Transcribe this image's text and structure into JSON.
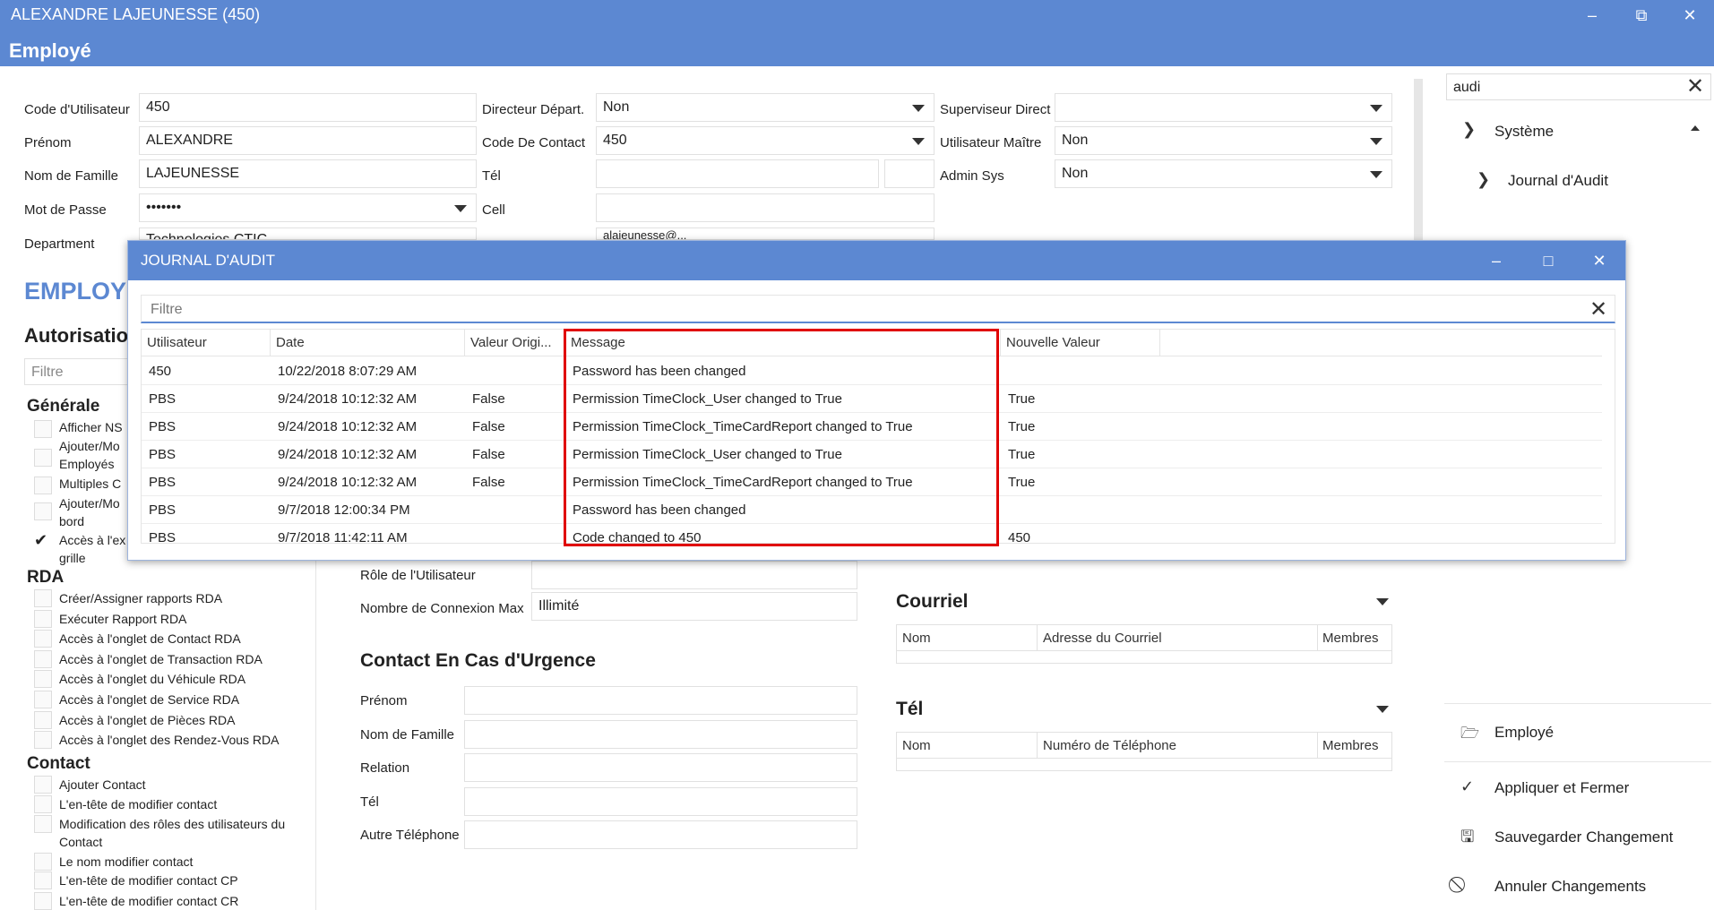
{
  "window": {
    "title": "ALEXANDRE LAJEUNESSE (450)",
    "subtitle": "Employé",
    "minimize_icon": "minimize-icon",
    "restore_icon": "restore-icon",
    "close_icon": "close-icon"
  },
  "form": {
    "col1": [
      {
        "label": "Code d'Utilisateur",
        "value": "450"
      },
      {
        "label": "Prénom",
        "value": "ALEXANDRE"
      },
      {
        "label": "Nom de Famille",
        "value": "LAJEUNESSE"
      },
      {
        "label": "Mot de Passe",
        "value": "•••••••"
      },
      {
        "label": "Department",
        "value": "Technologies CTIC"
      }
    ],
    "col2": [
      {
        "label": "Directeur Départ.",
        "value": "Non"
      },
      {
        "label": "Code De Contact",
        "value": "450"
      },
      {
        "label": "Tél",
        "value": ""
      },
      {
        "label": "Cell",
        "value": ""
      },
      {
        "label": "",
        "value": "alajeunesse@..."
      }
    ],
    "col3": [
      {
        "label": "Superviseur Direct",
        "value": ""
      },
      {
        "label": "Utilisateur Maître",
        "value": "Non"
      },
      {
        "label": "Admin Sys",
        "value": "Non"
      }
    ]
  },
  "left": {
    "heading": "EMPLOYÉ",
    "autorisation": "Autorisation",
    "filter_placeholder": "Filtre",
    "groups": {
      "generale": "Générale",
      "rda": "RDA",
      "contact": "Contact"
    },
    "generale_items": [
      "Afficher NS",
      "Ajouter/Mo",
      "Employés",
      "Multiples C",
      "Ajouter/Mo",
      "bord",
      "Accès à l'ex",
      "grille"
    ],
    "rda_items": [
      "Créer/Assigner rapports RDA",
      "Exécuter Rapport RDA",
      "Accès à l'onglet de Contact RDA",
      "Accès à l'onglet de Transaction RDA",
      "Accès à l'onglet du Véhicule RDA",
      "Accès à l'onglet de Service RDA",
      "Accès à l'onglet de Pièces RDA",
      "Accès à l'onglet des Rendez-Vous RDA"
    ],
    "contact_items": [
      "Ajouter Contact",
      "L'en-tête de modifier contact",
      "Modification des rôles des utilisateurs du",
      "Contact",
      "Le nom modifier contact",
      "L'en-tête de modifier contact CP",
      "L'en-tête de modifier contact CR"
    ]
  },
  "middle": {
    "role_label": "Rôle de l'Utilisateur",
    "role_value": "",
    "maxconn_label": "Nombre de Connexion Max",
    "maxconn_value": "Illimité",
    "emergency_title": "Contact En Cas d'Urgence",
    "emergency_fields": [
      "Prénom",
      "Nom de Famille",
      "Relation",
      "Tél",
      "Autre Téléphone"
    ]
  },
  "courriel": {
    "title": "Courriel",
    "headers": [
      "Nom",
      "Adresse du Courriel",
      "Membres"
    ]
  },
  "tel": {
    "title": "Tél",
    "headers": [
      "Nom",
      "Numéro de Téléphone",
      "Membres"
    ]
  },
  "right_panel": {
    "search_value": "audi",
    "tree": [
      {
        "label": "Système"
      },
      {
        "label": "Journal d'Audit"
      }
    ],
    "actions": [
      {
        "label": "Employé",
        "icon": "folder-open-icon"
      },
      {
        "label": "Appliquer et Fermer",
        "icon": "checkmark-icon"
      },
      {
        "label": "Sauvegarder Changement",
        "icon": "save-icon"
      },
      {
        "label": "Annuler Changements",
        "icon": "cancel-icon"
      }
    ]
  },
  "audit_dialog": {
    "title": "JOURNAL D'AUDIT",
    "filter_placeholder": "Filtre",
    "columns": [
      "Utilisateur",
      "Date",
      "Valeur Origi...",
      "Message",
      "Nouvelle Valeur"
    ],
    "rows": [
      {
        "user": "450",
        "date": "10/22/2018 8:07:29 AM",
        "orig": "",
        "message": "Password has been changed",
        "new": ""
      },
      {
        "user": "PBS",
        "date": "9/24/2018 10:12:32 AM",
        "orig": "False",
        "message": "Permission TimeClock_User changed to True",
        "new": "True"
      },
      {
        "user": "PBS",
        "date": "9/24/2018 10:12:32 AM",
        "orig": "False",
        "message": "Permission TimeClock_TimeCardReport changed to True",
        "new": "True"
      },
      {
        "user": "PBS",
        "date": "9/24/2018 10:12:32 AM",
        "orig": "False",
        "message": "Permission TimeClock_User changed to True",
        "new": "True"
      },
      {
        "user": "PBS",
        "date": "9/24/2018 10:12:32 AM",
        "orig": "False",
        "message": "Permission TimeClock_TimeCardReport changed to True",
        "new": "True"
      },
      {
        "user": "PBS",
        "date": "9/7/2018 12:00:34 PM",
        "orig": "",
        "message": "Password has been changed",
        "new": ""
      },
      {
        "user": "PBS",
        "date": "9/7/2018 11:42:11 AM",
        "orig": "",
        "message": "Code changed to 450",
        "new": "450"
      }
    ]
  }
}
